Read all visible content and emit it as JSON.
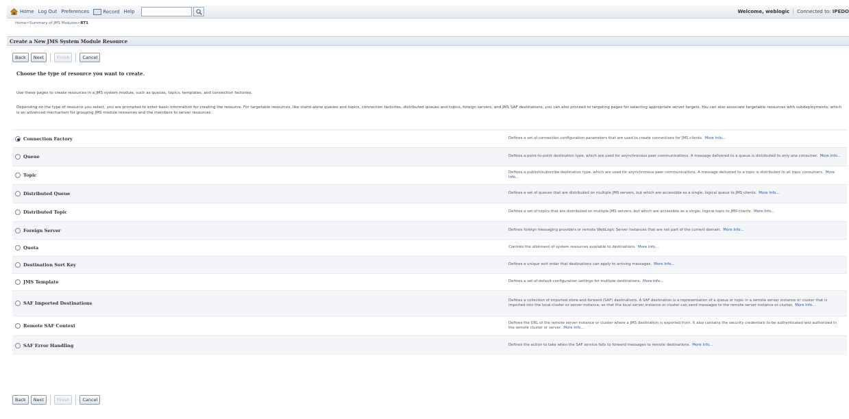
{
  "topbar": {
    "home": "Home",
    "logout": "Log Out",
    "preferences": "Preferences",
    "record": "Record",
    "help": "Help",
    "search_value": "",
    "welcome": "Welcome, weblogic",
    "connected_label": "Connected to:",
    "connected_domain": "IPEDO"
  },
  "breadcrumb": {
    "home": "Home",
    "sep": " >",
    "summary": "Summary of JMS Modules",
    "current": "RT1"
  },
  "page_title": "Create a New JMS System Module Resource",
  "buttons": {
    "back": "Back",
    "next": "Next",
    "finish": "Finish",
    "cancel": "Cancel"
  },
  "heading": "Choose the type of resource you want to create.",
  "intro": "Use these pages to create resources in a JMS system module, such as queues, topics, templates, and connection factories.",
  "intro2": "Depending on the type of resource you select, you are prompted to enter basic information for creating the resource. For targetable resources, like stand-alone queues and topics, connection factories, distributed queues and topics, foreign servers, and JMS SAF destinations, you can also proceed to targeting pages for selecting appropriate server targets. You can also associate targetable resources with subdeployments, which is an advanced mechanism for grouping JMS module resources and the members to server resources.",
  "more_info": "More Info...",
  "options": [
    {
      "label": "Connection Factory",
      "checked": true,
      "desc": "Defines a set of connection configuration parameters that are used to create connections for JMS clients."
    },
    {
      "label": "Queue",
      "checked": false,
      "desc": "Defines a point-to-point destination type, which are used for asynchronous peer communications. A message delivered to a queue is distributed to only one consumer."
    },
    {
      "label": "Topic",
      "checked": false,
      "desc": "Defines a publish/subscribe destination type, which are used for asynchronous peer communications. A message delivered to a topic is distributed to all topic consumers."
    },
    {
      "label": "Distributed Queue",
      "checked": false,
      "desc": "Defines a set of queues that are distributed on multiple JMS servers, but which are accessible as a single, logical queue to JMS clients."
    },
    {
      "label": "Distributed Topic",
      "checked": false,
      "desc": "Defines a set of topics that are distributed on multiple JMS servers, but which are accessible as a single, logical topic to JMS clients."
    },
    {
      "label": "Foreign Server",
      "checked": false,
      "desc": "Defines foreign messaging providers or remote WebLogic Server instances that are not part of the current domain."
    },
    {
      "label": "Quota",
      "checked": false,
      "desc": "Controls the allotment of system resources available to destinations."
    },
    {
      "label": "Destination Sort Key",
      "checked": false,
      "desc": "Defines a unique sort order that destinations can apply to arriving messages."
    },
    {
      "label": "JMS Template",
      "checked": false,
      "desc": "Defines a set of default configuration settings for multiple destinations."
    },
    {
      "label": "SAF Imported Destinations",
      "checked": false,
      "desc": "Defines a collection of imported store-and-forward (SAF) destinations. A SAF destination is a representation of a queue or topic in a remote server instance or cluster that is imported into the local cluster or server instance, so that the local server instance or cluster can send messages to the remote server instance or cluster."
    },
    {
      "label": "Remote SAF Context",
      "checked": false,
      "desc": "Defines the URL of the remote server instance or cluster where a JMS destination is exported from. It also contains the security credentials to be authenticated and authorized in the remote cluster or server."
    },
    {
      "label": "SAF Error Handling",
      "checked": false,
      "desc": "Defines the action to take when the SAF service fails to forward messages to remote destinations."
    }
  ]
}
